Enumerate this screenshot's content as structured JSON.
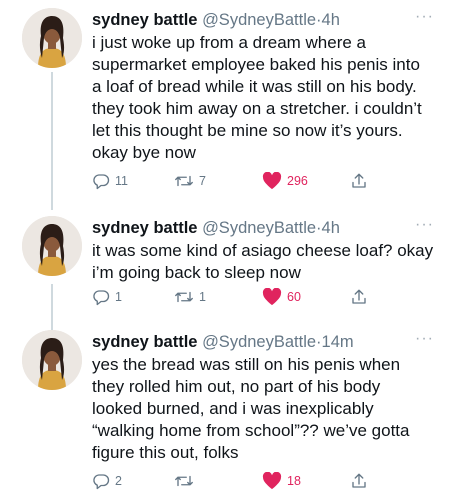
{
  "tweets": [
    {
      "name": "sydney battle",
      "handle": "@SydneyBattle",
      "separator": "·",
      "time": "4h",
      "more": "···",
      "text": "i just woke up from a dream where a supermarket employee baked his penis into a loaf of bread while it was still on his body. they took him away on a stretcher. i couldn’t let this thought be mine so now it’s yours. okay bye now",
      "replies": "11",
      "retweets": "7",
      "likes": "296"
    },
    {
      "name": "sydney battle",
      "handle": "@SydneyBattle",
      "separator": "·",
      "time": "4h",
      "more": "···",
      "text": "it was some kind of asiago cheese loaf? okay i’m going back to sleep now",
      "replies": "1",
      "retweets": "1",
      "likes": "60"
    },
    {
      "name": "sydney battle",
      "handle": "@SydneyBattle",
      "separator": "·",
      "time": "14m",
      "more": "···",
      "text": "yes the bread was still on his penis when they rolled him out, no part of his body looked burned, and i was inexplicably “walking home from school”?? we’ve gotta figure this out, folks",
      "replies": "2",
      "retweets": "",
      "likes": "18"
    }
  ],
  "icons": {
    "reply": "reply-icon",
    "retweet": "retweet-icon",
    "like": "heart-icon",
    "share": "share-icon"
  },
  "colors": {
    "like": "#e0245e",
    "muted": "#657786",
    "thread": "#cfd9de"
  }
}
